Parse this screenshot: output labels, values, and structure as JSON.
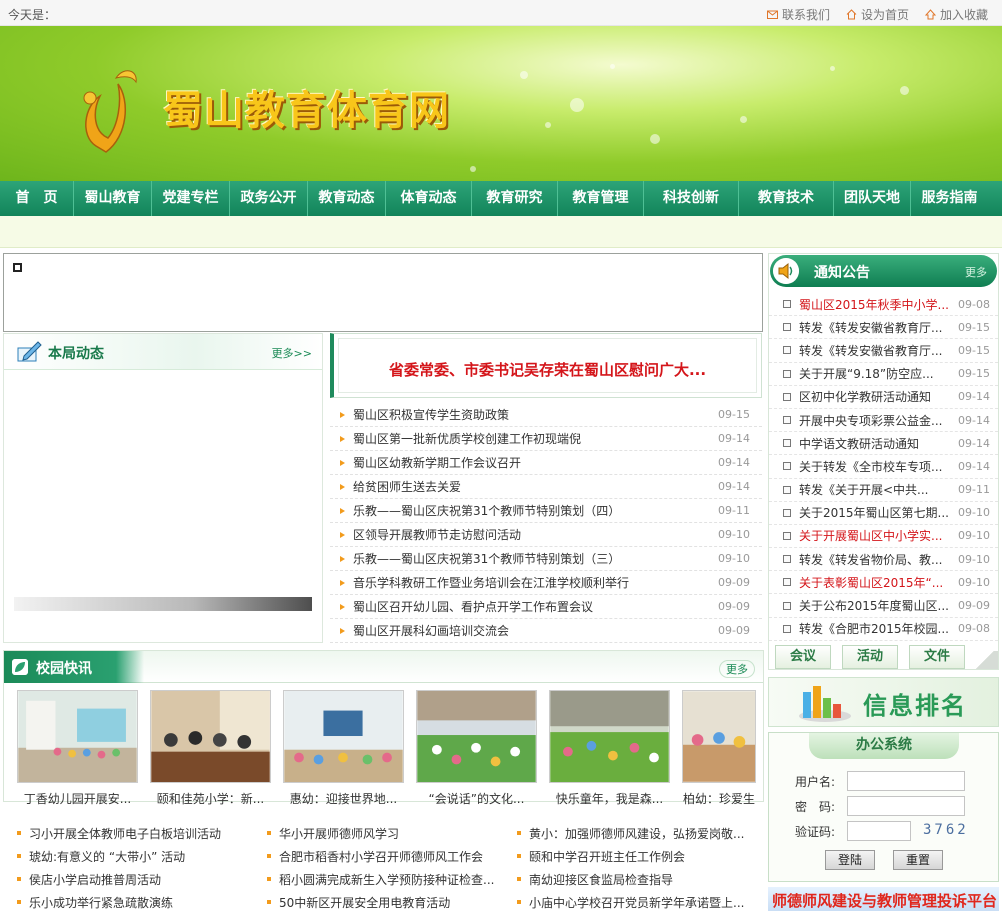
{
  "topbar": {
    "today_label": "今天是：",
    "links": [
      "联系我们",
      "设为首页",
      "加入收藏"
    ]
  },
  "header": {
    "site_title": "蜀山教育体育网"
  },
  "nav": {
    "items": [
      "首　页",
      "蜀山教育",
      "党建专栏",
      "政务公开",
      "教育动态",
      "体育动态",
      "教育研究",
      "教育管理",
      "科技创新",
      "教育技术",
      "团队天地",
      "服务指南"
    ]
  },
  "bureau": {
    "title": "本局动态",
    "more": "更多>>"
  },
  "headline": {
    "text": "省委常委、市委书记吴存荣在蜀山区慰问广大..."
  },
  "news": [
    {
      "title": "蜀山区积极宣传学生资助政策",
      "date": "09-15"
    },
    {
      "title": "蜀山区第一批新优质学校创建工作初现端倪",
      "date": "09-14"
    },
    {
      "title": "蜀山区幼教新学期工作会议召开",
      "date": "09-14"
    },
    {
      "title": "给贫困师生送去关爱",
      "date": "09-14"
    },
    {
      "title": "乐教——蜀山区庆祝第31个教师节特别策划（四）",
      "date": "09-11"
    },
    {
      "title": "区领导开展教师节走访慰问活动",
      "date": "09-10"
    },
    {
      "title": "乐教——蜀山区庆祝第31个教师节特别策划（三）",
      "date": "09-10"
    },
    {
      "title": "音乐学科教研工作暨业务培训会在江淮学校顺利举行",
      "date": "09-09"
    },
    {
      "title": "蜀山区召开幼儿园、看护点开学工作布置会议",
      "date": "09-09"
    },
    {
      "title": "蜀山区开展科幻画培训交流会",
      "date": "09-09"
    }
  ],
  "notices": {
    "title": "通知公告",
    "more": "更多",
    "items": [
      {
        "title": "蜀山区2015年秋季中小学...",
        "date": "09-08",
        "red": true
      },
      {
        "title": "转发《转发安徽省教育厅...",
        "date": "09-15",
        "red": false
      },
      {
        "title": "转发《转发安徽省教育厅...",
        "date": "09-15",
        "red": false
      },
      {
        "title": "关于开展“9.18”防空应...",
        "date": "09-15",
        "red": false
      },
      {
        "title": "区初中化学教研活动通知",
        "date": "09-14",
        "red": false
      },
      {
        "title": "开展中央专项彩票公益金...",
        "date": "09-14",
        "red": false
      },
      {
        "title": "中学语文教研活动通知",
        "date": "09-14",
        "red": false
      },
      {
        "title": "关于转发《全市校车专项...",
        "date": "09-14",
        "red": false
      },
      {
        "title": "转发《关于开展<中共...",
        "date": "09-11",
        "red": false
      },
      {
        "title": "关于2015年蜀山区第七期...",
        "date": "09-10",
        "red": false
      },
      {
        "title": "关于开展蜀山区中小学实...",
        "date": "09-10",
        "red": true
      },
      {
        "title": "转发《转发省物价局、教...",
        "date": "09-10",
        "red": false
      },
      {
        "title": "关于表彰蜀山区2015年“...",
        "date": "09-10",
        "red": true
      },
      {
        "title": "关于公布2015年度蜀山区...",
        "date": "09-09",
        "red": false
      },
      {
        "title": "转发《合肥市2015年校园...",
        "date": "09-08",
        "red": false
      }
    ],
    "tabs": [
      "会议",
      "活动",
      "文件"
    ]
  },
  "rank": {
    "title": "信息排名"
  },
  "office": {
    "title": "办公系统",
    "username_label": "用户名:",
    "password_label": "密　码:",
    "captcha_label": "验证码:",
    "captcha_code": "3762",
    "login": "登陆",
    "reset": "重置"
  },
  "slogan": {
    "text": "师德师风建设与教师管理投诉平台"
  },
  "campus": {
    "title": "校园快讯",
    "more": "更多",
    "photos": [
      {
        "caption": "丁香幼儿园开展安..."
      },
      {
        "caption": "颐和佳苑小学：新..."
      },
      {
        "caption": "惠幼：迎接世界地..."
      },
      {
        "caption": "“会说话”的文化..."
      },
      {
        "caption": "快乐童年，我是森..."
      },
      {
        "caption": "柏幼：珍爱生"
      }
    ]
  },
  "bottom_list": [
    "习小开展全体教师电子白板培训活动",
    "华小开展师德师风学习",
    "黄小：加强师德师风建设，弘扬爱岗敬...",
    "琥幼:有意义的 “大带小” 活动",
    "合肥市稻香村小学召开师德师风工作会",
    "颐和中学召开班主任工作例会",
    "侯店小学启动推普周活动",
    "稻小圆满完成新生入学预防接种证检查...",
    "南幼迎接区食监局检查指导",
    "乐小成功举行紧急疏散演练",
    "50中新区开展安全用电教育活动",
    "小庙中心学校召开党员新学年承诺暨上..."
  ],
  "colors": {
    "nav_green": "#12845a",
    "headline_red": "#d4151a",
    "banner_green": "#8fcb2a"
  }
}
